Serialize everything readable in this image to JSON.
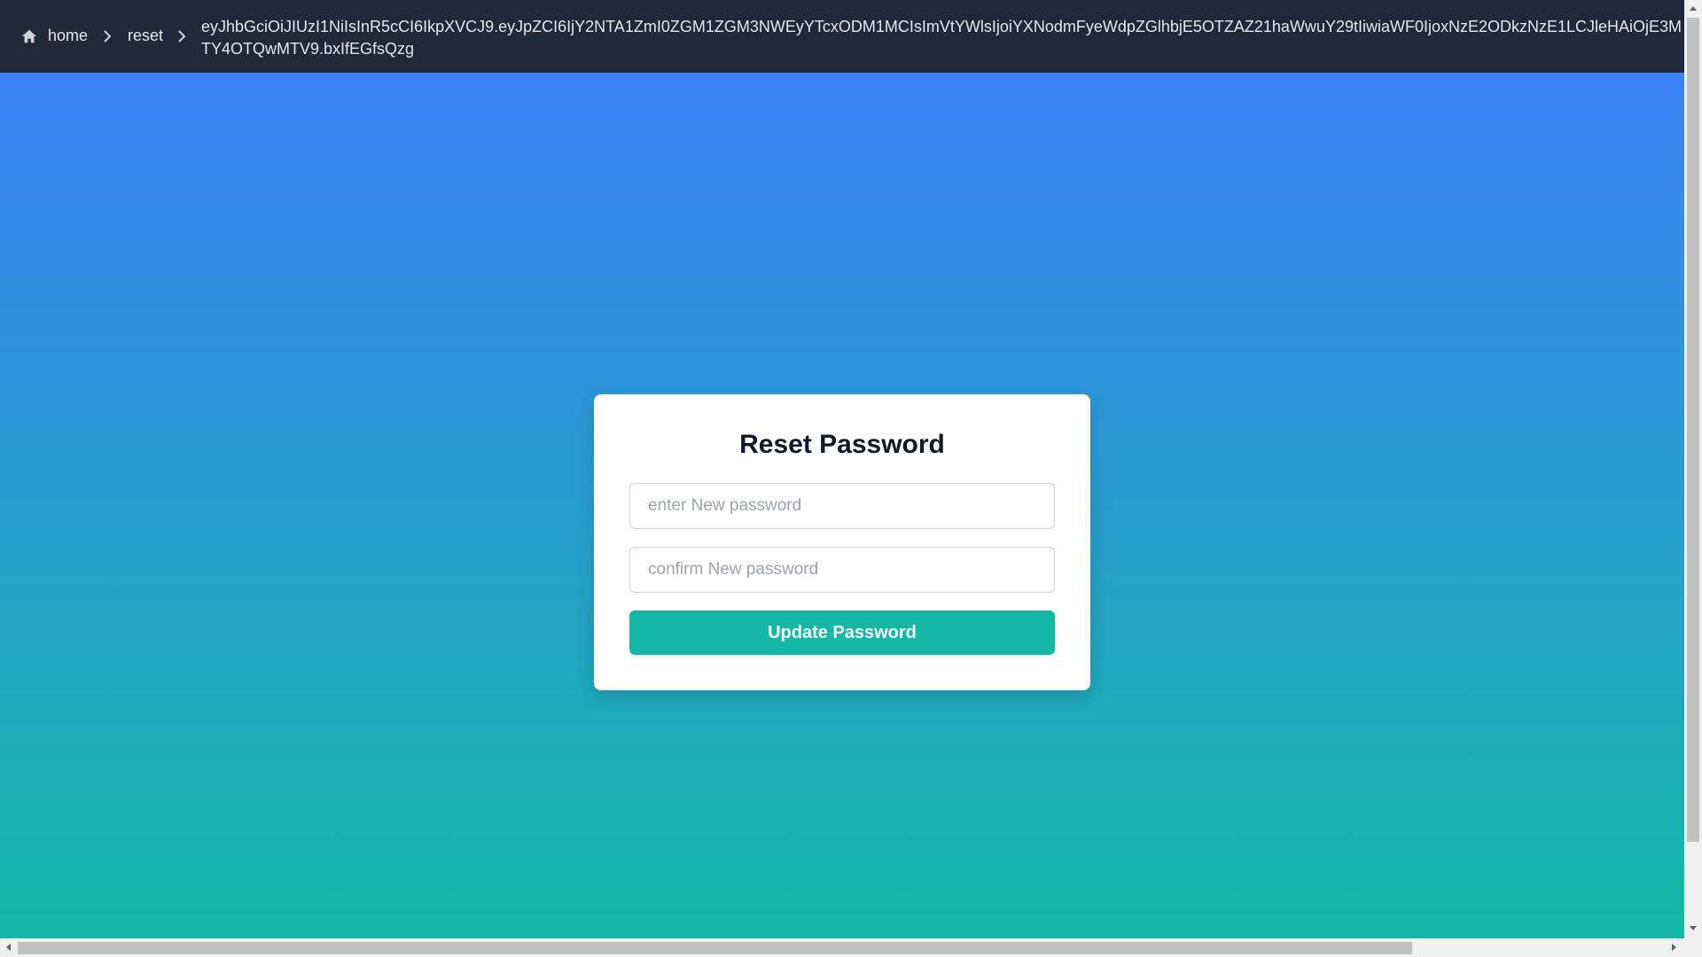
{
  "breadcrumb": {
    "home_label": "home",
    "reset_label": "reset",
    "token": "eyJhbGciOiJIUzI1NiIsInR5cCI6IkpXVCJ9.eyJpZCI6IjY2NTA1ZmI0ZGM1ZGM3NWEyYTcxODM1MCIsImVtYWlsIjoiYXNodmFyeWdpZGlhbjE5OTZAZ21haWwuY29tIiwiaWF0IjoxNzE2ODkzNzE1LCJleHAiOjE3MTY4OTQwMTV9.bxIfEGfsQzg"
  },
  "form": {
    "title": "Reset Password",
    "new_password_placeholder": "enter New password",
    "confirm_password_placeholder": "confirm New password",
    "submit_label": "Update Password"
  },
  "colors": {
    "nav_bg": "#1f2937",
    "gradient_top": "#3b82f6",
    "gradient_bottom": "#14b8a6",
    "button": "#14b8a6"
  }
}
